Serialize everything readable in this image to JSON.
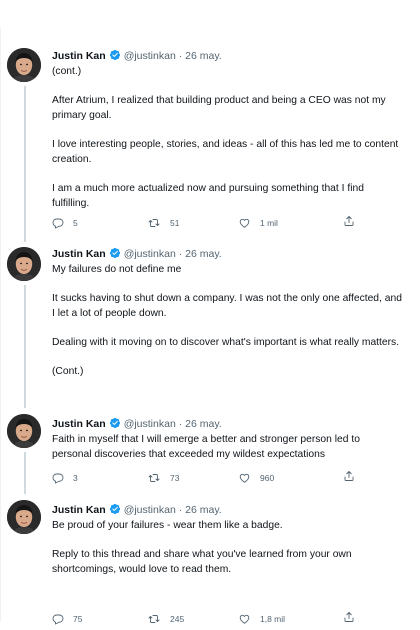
{
  "tweets": [
    {
      "name": "Justin Kan",
      "handle": "@justinkan",
      "separator": "·",
      "date": "26 may.",
      "paragraphs": [
        "(cont.)",
        "After Atrium, I realized that building product and being a CEO was not my primary goal.",
        "I love interesting people, stories, and ideas - all of this has led me to content creation.",
        "I am a much more actualized now and pursuing something that I find fulfilling."
      ],
      "replies": "5",
      "retweets": "51",
      "likes": "1 mil"
    },
    {
      "name": "Justin Kan",
      "handle": "@justinkan",
      "separator": "·",
      "date": "26 may.",
      "paragraphs": [
        "My failures do not define me",
        "It sucks having to shut down a company. I was not the only one affected, and I let a lot of people down.",
        "Dealing with it moving on to discover what's important is what really matters.",
        "(Cont.)"
      ]
    },
    {
      "name": "Justin Kan",
      "handle": "@justinkan",
      "separator": "·",
      "date": "26 may.",
      "paragraphs": [
        "Faith in myself that I will emerge a better and stronger person led to personal discoveries that exceeded my wildest expectations"
      ],
      "replies": "3",
      "retweets": "73",
      "likes": "960"
    },
    {
      "name": "Justin Kan",
      "handle": "@justinkan",
      "separator": "·",
      "date": "26 may.",
      "paragraphs": [
        "Be proud of your failures - wear them like a badge.",
        "Reply to this thread and share what you've learned from your own shortcomings, would love to read them."
      ],
      "replies": "75",
      "retweets": "245",
      "likes": "1,8 mil"
    }
  ],
  "icons": {
    "verified": "verified-badge-icon",
    "reply": "reply-icon",
    "retweet": "retweet-icon",
    "like": "like-icon",
    "share": "share-icon"
  },
  "colors": {
    "verified": "#1d9bf0",
    "text": "#0f1419",
    "secondary": "#536471",
    "rail": "#cfd9de"
  }
}
